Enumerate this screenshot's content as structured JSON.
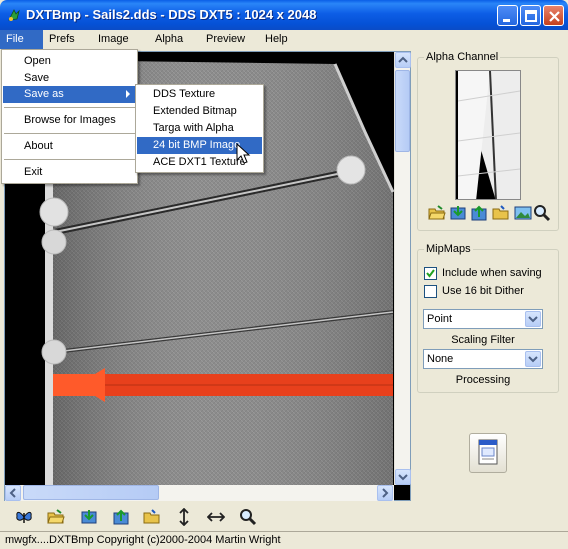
{
  "window": {
    "title": "DXTBmp - Sails2.dds - DDS DXT5 : 1024 x 2048",
    "icon": "app-icon",
    "controls": [
      "minimize-icon",
      "maximize-icon",
      "close-icon"
    ]
  },
  "menubar": {
    "items": [
      "File",
      "Prefs",
      "Image",
      "Alpha",
      "Preview",
      "Help"
    ]
  },
  "file_menu": {
    "items": [
      "Open",
      "Save",
      "Save as",
      "Browse for Images",
      "About",
      "Exit"
    ]
  },
  "save_as_submenu": {
    "items": [
      "DDS Texture",
      "Extended Bitmap",
      "Targa with Alpha",
      "24 bit BMP Image",
      "ACE DXT1 Texture"
    ],
    "highlighted": "24 bit BMP Image"
  },
  "alpha_channel": {
    "label": "Alpha Channel",
    "tools": [
      "open-folder-icon",
      "import-icon",
      "export-icon",
      "folder-icon",
      "picture-icon",
      "zoom-icon"
    ]
  },
  "mipmaps": {
    "label": "MipMaps",
    "include_when_saving": {
      "label": "Include when saving",
      "checked": true
    },
    "dither_16bit": {
      "label": "Use 16 bit Dither",
      "checked": false
    },
    "scaling_filter": {
      "value": "Point",
      "caption": "Scaling Filter"
    },
    "processing": {
      "value": "None",
      "caption": "Processing"
    }
  },
  "bottom_toolbar": {
    "tools": [
      "butterfly-icon",
      "open-folder-icon",
      "import-icon",
      "export-icon",
      "folder-icon",
      "flip-vertical-icon",
      "flip-horizontal-icon",
      "zoom-icon"
    ]
  },
  "status": {
    "text": "mwgfx....DXTBmp Copyright (c)2000-2004 Martin Wright"
  },
  "colors": {
    "title_blue": "#0551d6",
    "menu_highlight": "#316ac5",
    "window_bg": "#ece9d8",
    "stripe_red": "#e8401c"
  }
}
